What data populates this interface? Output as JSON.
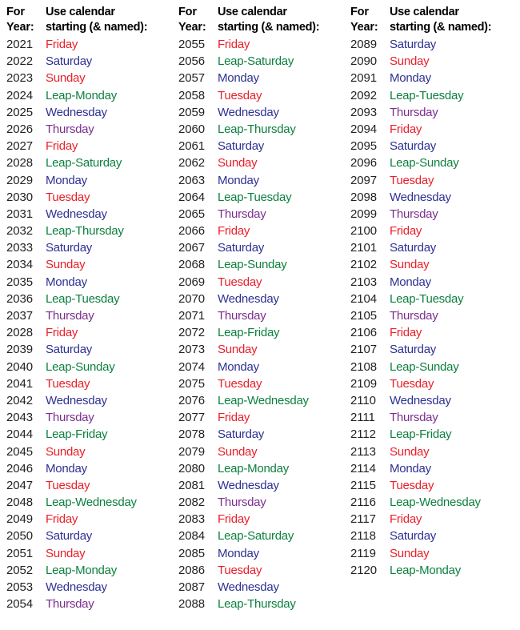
{
  "title": "Perpetual Calendar Year Index",
  "header": {
    "for_year_line1": "For",
    "for_year_line2": "Year:",
    "use_calendar_line1": "Use calendar",
    "use_calendar_line2": "starting (& named):"
  },
  "colors": {
    "red": "#e8202a",
    "blue": "#2e3192",
    "green": "#0e8040",
    "purple": "#7b2e8e",
    "black": "#231f20",
    "background": "#ffffff"
  },
  "color_legend": {
    "red": "Friday, Sunday, Tuesday",
    "blue": "Saturday, Monday, Wednesday",
    "purple": "Thursday",
    "green": "Leap years (Leap-Weekday)"
  },
  "columns": [
    {
      "index": 0,
      "rows": [
        {
          "year": "2021",
          "day": "Friday",
          "color": "red"
        },
        {
          "year": "2022",
          "day": "Saturday",
          "color": "blue"
        },
        {
          "year": "2023",
          "day": "Sunday",
          "color": "red"
        },
        {
          "year": "2024",
          "day": "Leap-Monday",
          "color": "green"
        },
        {
          "year": "2025",
          "day": "Wednesday",
          "color": "blue"
        },
        {
          "year": "2026",
          "day": "Thursday",
          "color": "purple"
        },
        {
          "year": "2027",
          "day": "Friday",
          "color": "red"
        },
        {
          "year": "2028",
          "day": "Leap-Saturday",
          "color": "green"
        },
        {
          "year": "2029",
          "day": "Monday",
          "color": "blue"
        },
        {
          "year": "2030",
          "day": "Tuesday",
          "color": "red"
        },
        {
          "year": "2031",
          "day": "Wednesday",
          "color": "blue"
        },
        {
          "year": "2032",
          "day": "Leap-Thursday",
          "color": "green"
        },
        {
          "year": "2033",
          "day": "Saturday",
          "color": "blue"
        },
        {
          "year": "2034",
          "day": "Sunday",
          "color": "red"
        },
        {
          "year": "2035",
          "day": "Monday",
          "color": "blue"
        },
        {
          "year": "2036",
          "day": "Leap-Tuesday",
          "color": "green"
        },
        {
          "year": "2037",
          "day": "Thursday",
          "color": "purple"
        },
        {
          "year": "2028",
          "day": "Friday",
          "color": "red"
        },
        {
          "year": "2039",
          "day": "Saturday",
          "color": "blue"
        },
        {
          "year": "2040",
          "day": "Leap-Sunday",
          "color": "green"
        },
        {
          "year": "2041",
          "day": "Tuesday",
          "color": "red"
        },
        {
          "year": "2042",
          "day": "Wednesday",
          "color": "blue"
        },
        {
          "year": "2043",
          "day": "Thursday",
          "color": "purple"
        },
        {
          "year": "2044",
          "day": "Leap-Friday",
          "color": "green"
        },
        {
          "year": "2045",
          "day": "Sunday",
          "color": "red"
        },
        {
          "year": "2046",
          "day": "Monday",
          "color": "blue"
        },
        {
          "year": "2047",
          "day": "Tuesday",
          "color": "red"
        },
        {
          "year": "2048",
          "day": "Leap-Wednesday",
          "color": "green"
        },
        {
          "year": "2049",
          "day": "Friday",
          "color": "red"
        },
        {
          "year": "2050",
          "day": "Saturday",
          "color": "blue"
        },
        {
          "year": "2051",
          "day": "Sunday",
          "color": "red"
        },
        {
          "year": "2052",
          "day": "Leap-Monday",
          "color": "green"
        },
        {
          "year": "2053",
          "day": "Wednesday",
          "color": "blue"
        },
        {
          "year": "2054",
          "day": "Thursday",
          "color": "purple"
        }
      ]
    },
    {
      "index": 1,
      "rows": [
        {
          "year": "2055",
          "day": "Friday",
          "color": "red"
        },
        {
          "year": "2056",
          "day": "Leap-Saturday",
          "color": "green"
        },
        {
          "year": "2057",
          "day": "Monday",
          "color": "blue"
        },
        {
          "year": "2058",
          "day": "Tuesday",
          "color": "red"
        },
        {
          "year": "2059",
          "day": "Wednesday",
          "color": "blue"
        },
        {
          "year": "2060",
          "day": "Leap-Thursday",
          "color": "green"
        },
        {
          "year": "2061",
          "day": "Saturday",
          "color": "blue"
        },
        {
          "year": "2062",
          "day": "Sunday",
          "color": "red"
        },
        {
          "year": "2063",
          "day": "Monday",
          "color": "blue"
        },
        {
          "year": "2064",
          "day": "Leap-Tuesday",
          "color": "green"
        },
        {
          "year": "2065",
          "day": "Thursday",
          "color": "purple"
        },
        {
          "year": "2066",
          "day": "Friday",
          "color": "red"
        },
        {
          "year": "2067",
          "day": "Saturday",
          "color": "blue"
        },
        {
          "year": "2068",
          "day": "Leap-Sunday",
          "color": "green"
        },
        {
          "year": "2069",
          "day": "Tuesday",
          "color": "red"
        },
        {
          "year": "2070",
          "day": "Wednesday",
          "color": "blue"
        },
        {
          "year": "2071",
          "day": "Thursday",
          "color": "purple"
        },
        {
          "year": "2072",
          "day": "Leap-Friday",
          "color": "green"
        },
        {
          "year": "2073",
          "day": "Sunday",
          "color": "red"
        },
        {
          "year": "2074",
          "day": "Monday",
          "color": "blue"
        },
        {
          "year": "2075",
          "day": "Tuesday",
          "color": "red"
        },
        {
          "year": "2076",
          "day": "Leap-Wednesday",
          "color": "green"
        },
        {
          "year": "2077",
          "day": "Friday",
          "color": "red"
        },
        {
          "year": "2078",
          "day": "Saturday",
          "color": "blue"
        },
        {
          "year": "2079",
          "day": "Sunday",
          "color": "red"
        },
        {
          "year": "2080",
          "day": "Leap-Monday",
          "color": "green"
        },
        {
          "year": "2081",
          "day": "Wednesday",
          "color": "blue"
        },
        {
          "year": "2082",
          "day": "Thursday",
          "color": "purple"
        },
        {
          "year": "2083",
          "day": "Friday",
          "color": "red"
        },
        {
          "year": "2084",
          "day": "Leap-Saturday",
          "color": "green"
        },
        {
          "year": "2085",
          "day": "Monday",
          "color": "blue"
        },
        {
          "year": "2086",
          "day": "Tuesday",
          "color": "red"
        },
        {
          "year": "2087",
          "day": "Wednesday",
          "color": "blue"
        },
        {
          "year": "2088",
          "day": "Leap-Thursday",
          "color": "green"
        }
      ]
    },
    {
      "index": 2,
      "rows": [
        {
          "year": "2089",
          "day": "Saturday",
          "color": "blue"
        },
        {
          "year": "2090",
          "day": "Sunday",
          "color": "red"
        },
        {
          "year": "2091",
          "day": "Monday",
          "color": "blue"
        },
        {
          "year": "2092",
          "day": "Leap-Tuesday",
          "color": "green"
        },
        {
          "year": "2093",
          "day": "Thursday",
          "color": "purple"
        },
        {
          "year": "2094",
          "day": "Friday",
          "color": "red"
        },
        {
          "year": "2095",
          "day": "Saturday",
          "color": "blue"
        },
        {
          "year": "2096",
          "day": "Leap-Sunday",
          "color": "green"
        },
        {
          "year": "2097",
          "day": "Tuesday",
          "color": "red"
        },
        {
          "year": "2098",
          "day": "Wednesday",
          "color": "blue"
        },
        {
          "year": "2099",
          "day": "Thursday",
          "color": "purple"
        },
        {
          "year": "2100",
          "day": "Friday",
          "color": "red"
        },
        {
          "year": "2101",
          "day": "Saturday",
          "color": "blue"
        },
        {
          "year": "2102",
          "day": "Sunday",
          "color": "red"
        },
        {
          "year": "2103",
          "day": "Monday",
          "color": "blue"
        },
        {
          "year": "2104",
          "day": "Leap-Tuesday",
          "color": "green"
        },
        {
          "year": "2105",
          "day": "Thursday",
          "color": "purple"
        },
        {
          "year": "2106",
          "day": "Friday",
          "color": "red"
        },
        {
          "year": "2107",
          "day": "Saturday",
          "color": "blue"
        },
        {
          "year": "2108",
          "day": "Leap-Sunday",
          "color": "green"
        },
        {
          "year": "2109",
          "day": "Tuesday",
          "color": "red"
        },
        {
          "year": "2110",
          "day": "Wednesday",
          "color": "blue"
        },
        {
          "year": "2111",
          "day": "Thursday",
          "color": "purple"
        },
        {
          "year": "2112",
          "day": "Leap-Friday",
          "color": "green"
        },
        {
          "year": "2113",
          "day": "Sunday",
          "color": "red"
        },
        {
          "year": "2114",
          "day": "Monday",
          "color": "blue"
        },
        {
          "year": "2115",
          "day": "Tuesday",
          "color": "red"
        },
        {
          "year": "2116",
          "day": "Leap-Wednesday",
          "color": "green"
        },
        {
          "year": "2117",
          "day": "Friday",
          "color": "red"
        },
        {
          "year": "2118",
          "day": "Saturday",
          "color": "blue"
        },
        {
          "year": "2119",
          "day": "Sunday",
          "color": "red"
        },
        {
          "year": "2120",
          "day": "Leap-Monday",
          "color": "green"
        }
      ]
    }
  ]
}
